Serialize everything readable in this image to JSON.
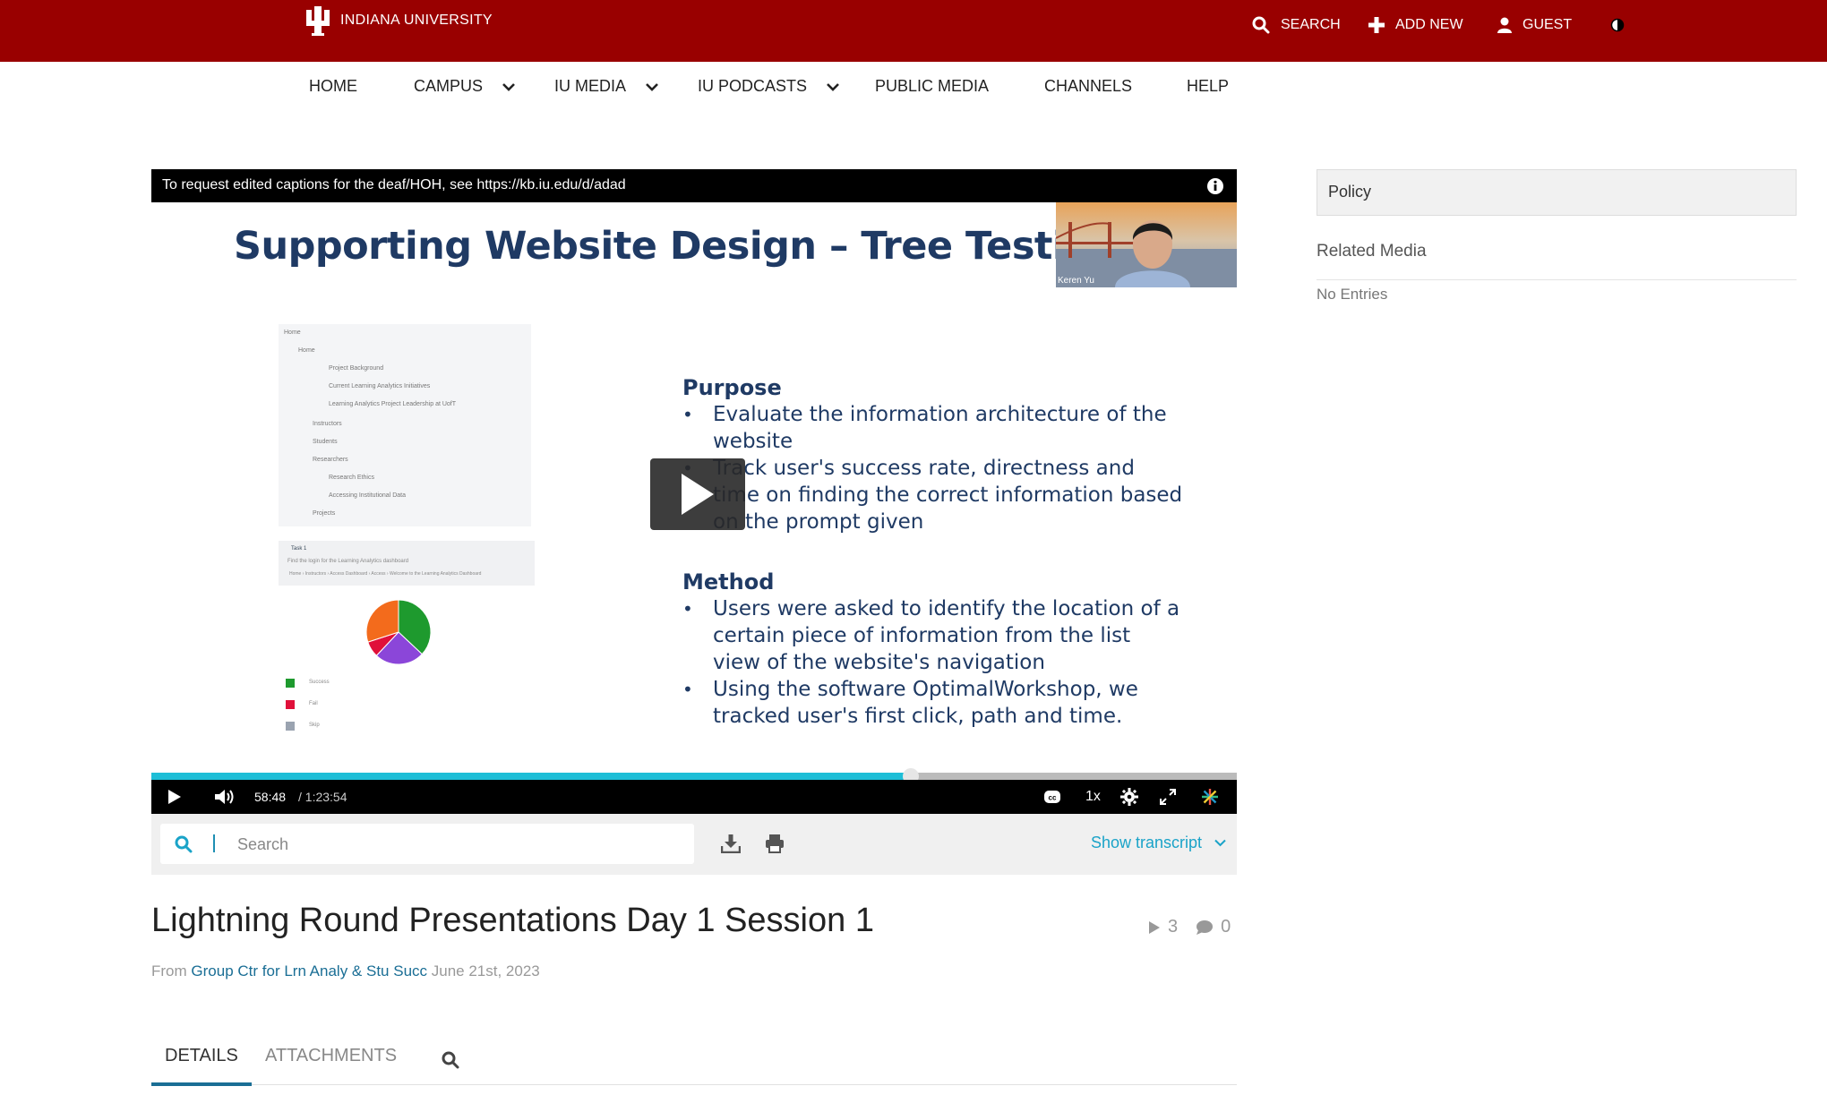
{
  "header": {
    "logo_text": "INDIANA UNIVERSITY",
    "search_label": "SEARCH",
    "add_new_label": "ADD NEW",
    "guest_label": "GUEST"
  },
  "nav": {
    "items": [
      "HOME",
      "CAMPUS",
      "IU MEDIA",
      "IU PODCASTS",
      "PUBLIC MEDIA",
      "CHANNELS",
      "HELP"
    ]
  },
  "player": {
    "caption_notice": "To request edited captions for the deaf/HOH, see https://kb.iu.edu/d/adad",
    "webcam_name": "Keren Yu",
    "slide": {
      "title": "Supporting Website Design – Tree Testing",
      "purpose_heading": "Purpose",
      "purpose_bullets": [
        "Evaluate the information architecture of the website",
        "Track user's success rate, directness and time on finding the correct information based on the prompt given"
      ],
      "method_heading": "Method",
      "method_bullets": [
        "Users were asked to identify the location of a certain piece of information from the list view of the website's navigation",
        "Using the software OptimalWorkshop, we tracked user's first click, path and time."
      ],
      "tree_items": [
        "Home",
        "Home",
        "Project Background",
        "Current Learning Analytics Initiatives",
        "Learning Analytics Project Leadership at UofT",
        "Instructors",
        "Students",
        "Researchers",
        "Research Ethics",
        "Accessing Institutional Data",
        "Projects"
      ],
      "task_label": "Task 1",
      "task_text": "Find the login for the Learning Analytics dashboard",
      "task_path": "Home › Instructors › Access Dashboard › Access › Welcome to the Learning Analytics Dashboard",
      "legend_rows": [
        "Success",
        "Fail",
        "Skip"
      ],
      "pie_values": [
        0.37,
        0.25,
        0.08,
        0.3
      ],
      "pie_colors": [
        "#1e9a2e",
        "#8b46d9",
        "#e0103a",
        "#f36b1c"
      ]
    },
    "current_time": "58:48",
    "duration": "/ 1:23:54",
    "progress": 0.7,
    "speed": "1x",
    "accent_color": "#1ebed7"
  },
  "transcript": {
    "search_placeholder": "Search",
    "show_label": "Show transcript"
  },
  "entry": {
    "title": "Lightning Round Presentations Day 1 Session 1",
    "plays": "3",
    "comments": "0",
    "from_label": "From",
    "owner": "Group Ctr for Lrn Analy & Stu Succ",
    "date": "June 21st, 2023"
  },
  "tabs": [
    "DETAILS",
    "ATTACHMENTS"
  ],
  "sidebar": {
    "policy": "Policy",
    "related_title": "Related Media",
    "no_entries": "No Entries"
  },
  "colors": {
    "brand": "#990000",
    "link": "#1a6e95",
    "transcript_link": "#1aa3c8"
  }
}
